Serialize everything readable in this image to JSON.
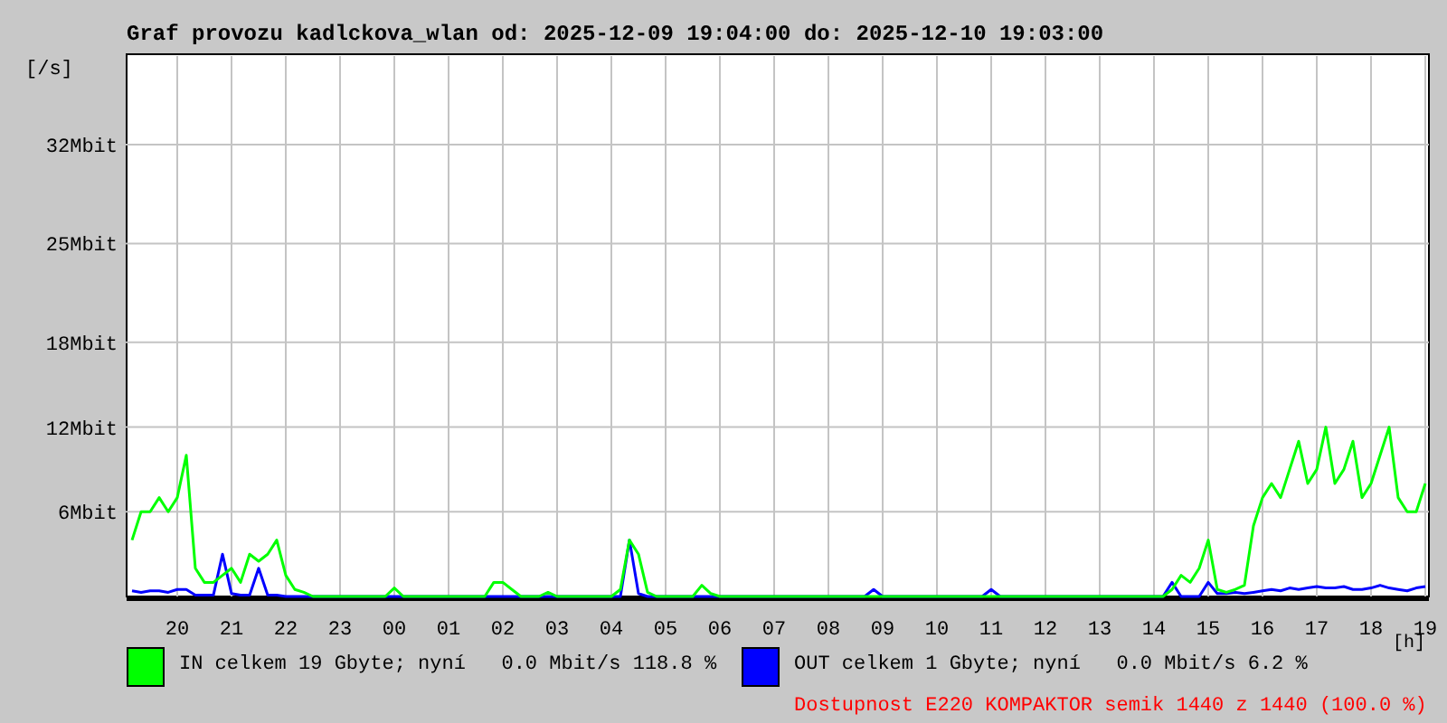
{
  "chart_data": {
    "type": "line",
    "title": "Graf provozu kadlckova_wlan od: 2025-12-09 19:04:00 do: 2025-12-10 19:03:00",
    "xlabel": "[h]",
    "ylabel": "[/s]",
    "categories": [
      null,
      null,
      null,
      null,
      null,
      "20",
      null,
      null,
      null,
      null,
      null,
      "21",
      null,
      null,
      null,
      null,
      null,
      "22",
      null,
      null,
      null,
      null,
      null,
      "23",
      null,
      null,
      null,
      null,
      null,
      "00",
      null,
      null,
      null,
      null,
      null,
      "01",
      null,
      null,
      null,
      null,
      null,
      "02",
      null,
      null,
      null,
      null,
      null,
      "03",
      null,
      null,
      null,
      null,
      null,
      "04",
      null,
      null,
      null,
      null,
      null,
      "05",
      null,
      null,
      null,
      null,
      null,
      "06",
      null,
      null,
      null,
      null,
      null,
      "07",
      null,
      null,
      null,
      null,
      null,
      "08",
      null,
      null,
      null,
      null,
      null,
      "09",
      null,
      null,
      null,
      null,
      null,
      "10",
      null,
      null,
      null,
      null,
      null,
      "11",
      null,
      null,
      null,
      null,
      null,
      "12",
      null,
      null,
      null,
      null,
      null,
      "13",
      null,
      null,
      null,
      null,
      null,
      "14",
      null,
      null,
      null,
      null,
      null,
      "15",
      null,
      null,
      null,
      null,
      null,
      "16",
      null,
      null,
      null,
      null,
      null,
      "17",
      null,
      null,
      null,
      null,
      null,
      "18",
      null,
      null,
      null,
      null,
      null,
      "19"
    ],
    "series": [
      {
        "name": "IN celkem 19 Gbyte; nyní   0.0 Mbit/s 118.8 %",
        "color": "#00ff00",
        "values": [
          4,
          6,
          6,
          7,
          6,
          7,
          10,
          2,
          1,
          1,
          1.5,
          2,
          1,
          3,
          2.5,
          3,
          4,
          1.5,
          0.5,
          0.3,
          0,
          0,
          0,
          0,
          0,
          0,
          0,
          0,
          0,
          0.6,
          0,
          0,
          0,
          0,
          0,
          0,
          0,
          0,
          0,
          0,
          1,
          1,
          0.5,
          0,
          0,
          0,
          0.3,
          0,
          0,
          0,
          0,
          0,
          0,
          0,
          0.5,
          4,
          3,
          0.3,
          0,
          0,
          0,
          0,
          0,
          0.8,
          0.2,
          0,
          0,
          0,
          0,
          0,
          0,
          0,
          0,
          0,
          0,
          0,
          0,
          0,
          0,
          0,
          0,
          0,
          0,
          0,
          0,
          0,
          0,
          0,
          0,
          0,
          0,
          0,
          0,
          0,
          0,
          0,
          0,
          0,
          0,
          0,
          0,
          0,
          0,
          0,
          0,
          0,
          0,
          0,
          0,
          0,
          0,
          0,
          0,
          0,
          0,
          0.5,
          1.5,
          1,
          2,
          4,
          0.5,
          0.3,
          0.5,
          0.8,
          5,
          7,
          8,
          7,
          9,
          11,
          8,
          9,
          12,
          8,
          9,
          11,
          7,
          8,
          10,
          12,
          7,
          6,
          6,
          8
        ]
      },
      {
        "name": "OUT celkem 1 Gbyte; nyní   0.0 Mbit/s 6.2 %",
        "color": "#0000ff",
        "values": [
          0.4,
          0.3,
          0.4,
          0.4,
          0.3,
          0.5,
          0.5,
          0.1,
          0.1,
          0.1,
          3,
          0.2,
          0.1,
          0.1,
          2,
          0.1,
          0.1,
          0,
          0,
          0,
          0,
          0,
          0,
          0,
          0,
          0,
          0,
          0,
          0,
          0,
          0,
          0,
          0,
          0,
          0,
          0,
          0,
          0,
          0,
          0,
          0,
          0,
          0,
          0,
          0,
          0,
          0,
          0,
          0,
          0,
          0,
          0,
          0,
          0,
          0,
          4,
          0.2,
          0,
          0,
          0,
          0,
          0,
          0,
          0,
          0,
          0,
          0,
          0,
          0,
          0,
          0,
          0,
          0,
          0,
          0,
          0,
          0,
          0,
          0,
          0,
          0,
          0,
          0.5,
          0,
          0,
          0,
          0,
          0,
          0,
          0,
          0,
          0,
          0,
          0,
          0,
          0.5,
          0,
          0,
          0,
          0,
          0,
          0,
          0,
          0,
          0,
          0,
          0,
          0,
          0,
          0,
          0,
          0,
          0,
          0,
          0,
          1,
          0,
          0,
          0,
          1,
          0.2,
          0.2,
          0.3,
          0.2,
          0.3,
          0.4,
          0.5,
          0.4,
          0.6,
          0.5,
          0.6,
          0.7,
          0.6,
          0.6,
          0.7,
          0.5,
          0.5,
          0.6,
          0.8,
          0.6,
          0.5,
          0.4,
          0.6,
          0.7
        ]
      }
    ],
    "ylim": [
      0,
      38.4
    ],
    "grid": true,
    "yticks": [
      {
        "value": 6,
        "label": "6Mbit"
      },
      {
        "value": 12,
        "label": "12Mbit"
      },
      {
        "value": 18,
        "label": "18Mbit"
      },
      {
        "value": 25,
        "label": "25Mbit"
      },
      {
        "value": 32,
        "label": "32Mbit"
      }
    ]
  },
  "availability": "Dostupnost E220 KOMPAKTOR semik 1440 z 1440 (100.0 %)"
}
